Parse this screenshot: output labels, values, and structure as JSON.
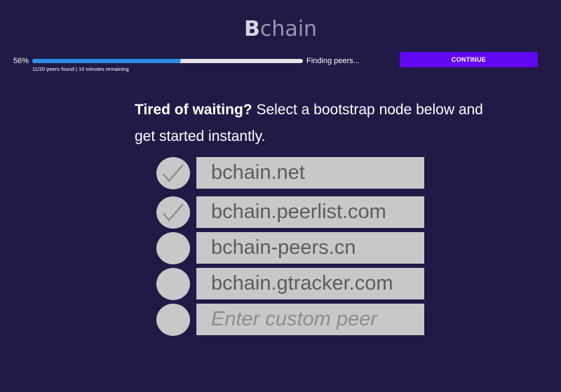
{
  "app": {
    "logo_bold": "B",
    "logo_rest": "chain"
  },
  "progress": {
    "percent_label": "56%",
    "fraction": 0.55,
    "detail": "11/20 peers found | 10 minutes remaining",
    "status": "Finding peers..."
  },
  "actions": {
    "continue_label": "CONTINUE"
  },
  "prompt": {
    "bold": "Tired of waiting?",
    "rest": " Select a bootstrap node below and get started instantly."
  },
  "nodes": [
    {
      "label": "bchain.net",
      "checked": true
    },
    {
      "label": "bchain.peerlist.com",
      "checked": true
    },
    {
      "label": "bchain-peers.cn",
      "checked": false
    },
    {
      "label": "bchain.gtracker.com",
      "checked": false
    }
  ],
  "custom": {
    "placeholder": "Enter custom peer",
    "value": ""
  },
  "colors": {
    "background": "#1f1a46",
    "accent": "#6206f0",
    "progress_fill": "#2f8fe6",
    "item_bg": "#c8c8c8"
  }
}
